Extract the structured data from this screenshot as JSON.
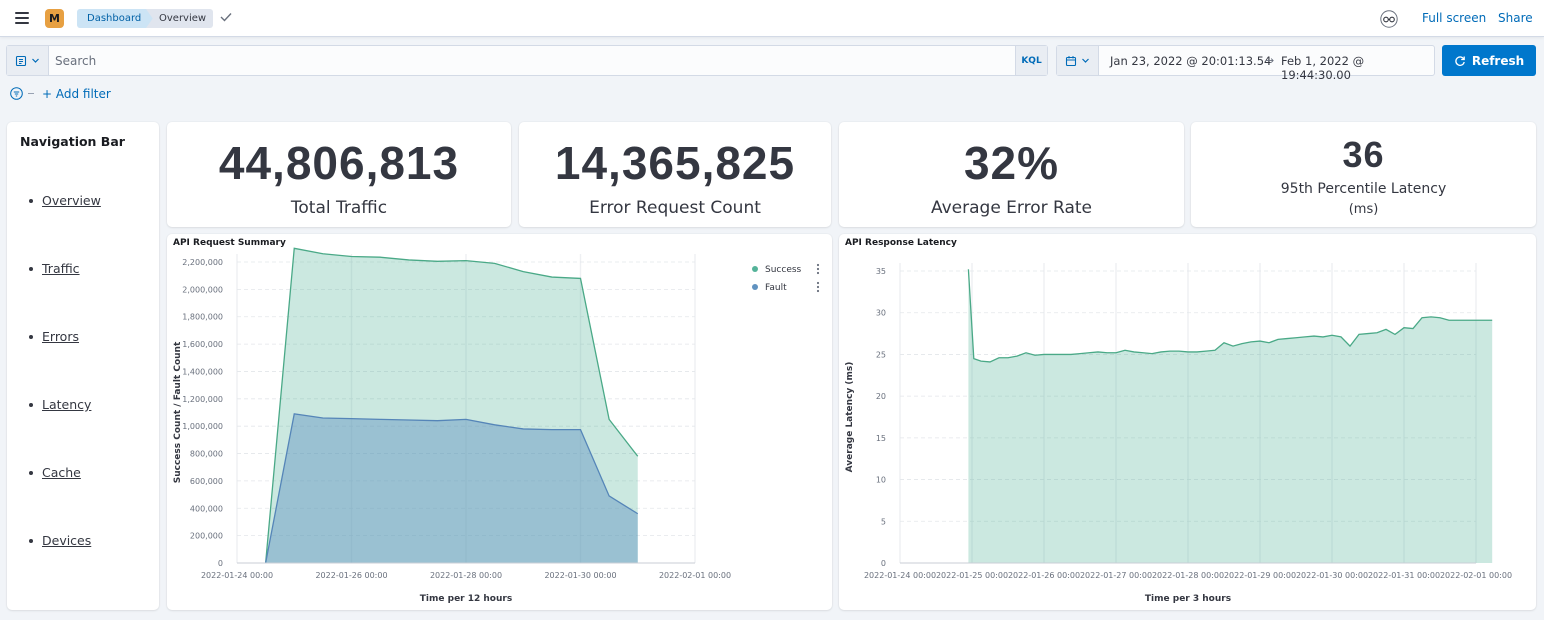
{
  "header": {
    "avatar_letter": "M",
    "breadcrumbs": [
      "Dashboard",
      "Overview"
    ],
    "full_screen": "Full screen",
    "share": "Share"
  },
  "query": {
    "search_placeholder": "Search",
    "kql": "KQL",
    "date_start": "Jan 23, 2022 @ 20:01:13.54",
    "date_arrow": "→",
    "date_end": "Feb 1, 2022 @ 19:44:30.00",
    "refresh": "Refresh",
    "add_filter": "+ Add filter"
  },
  "nav": {
    "title": "Navigation Bar",
    "items": [
      "Overview",
      "Traffic",
      "Errors",
      "Latency",
      "Cache",
      "Devices"
    ]
  },
  "metrics": [
    {
      "value": "44,806,813",
      "label": "Total Traffic"
    },
    {
      "value": "14,365,825",
      "label": "Error Request Count"
    },
    {
      "value": "32%",
      "label": "Average Error Rate"
    },
    {
      "value": "36",
      "label": "95th Percentile Latency",
      "label2": "(ms)"
    }
  ],
  "colors": {
    "success": "#54b399",
    "fault": "#6092c0",
    "accent": "#0077cc"
  },
  "charts": {
    "request_title": "API Request Summary",
    "latency_title": "API Response Latency"
  },
  "chart_data": [
    {
      "type": "area",
      "title": "API Request Summary",
      "xlabel": "Time per 12 hours",
      "ylabel": "Success Count / Fault Count",
      "ylim": [
        0,
        2200000
      ],
      "yticks": [
        0,
        200000,
        400000,
        600000,
        800000,
        1000000,
        1200000,
        1400000,
        1600000,
        1800000,
        2000000,
        2200000
      ],
      "ytick_labels": [
        "0",
        "200,000",
        "400,000",
        "600,000",
        "800,000",
        "1,000,000",
        "1,200,000",
        "1,400,000",
        "1,600,000",
        "1,800,000",
        "2,000,000",
        "2,200,000"
      ],
      "xlim": [
        0,
        16
      ],
      "xticks": [
        0,
        4,
        8,
        12,
        16
      ],
      "xtick_labels": [
        "2022-01-24 00:00",
        "2022-01-26 00:00",
        "2022-01-28 00:00",
        "2022-01-30 00:00",
        "2022-02-01 00:00"
      ],
      "legend_position": "top-right",
      "grid": true,
      "x": [
        1,
        2,
        3,
        4,
        5,
        6,
        7,
        8,
        9,
        10,
        11,
        12,
        13,
        14,
        15
      ],
      "series": [
        {
          "name": "Success",
          "values": [
            0,
            2300000,
            2260000,
            2240000,
            2235000,
            2215000,
            2205000,
            2210000,
            2190000,
            2130000,
            2090000,
            2080000,
            1050000,
            780000,
            null
          ]
        },
        {
          "name": "Fault",
          "values": [
            0,
            1090000,
            1060000,
            1055000,
            1050000,
            1045000,
            1040000,
            1050000,
            1010000,
            980000,
            975000,
            975000,
            490000,
            360000,
            null
          ]
        }
      ]
    },
    {
      "type": "area",
      "title": "API Response Latency",
      "xlabel": "Time per 3 hours",
      "ylabel": "Average Latency (ms)",
      "ylim": [
        0,
        35
      ],
      "yticks": [
        0,
        5,
        10,
        15,
        20,
        25,
        30,
        35
      ],
      "xlim": [
        0,
        64
      ],
      "xticks": [
        0,
        8,
        16,
        24,
        32,
        40,
        48,
        56,
        64
      ],
      "xtick_labels": [
        "2022-01-24 00:00",
        "2022-01-25 00:00",
        "2022-01-26 00:00",
        "2022-01-27 00:00",
        "2022-01-28 00:00",
        "2022-01-29 00:00",
        "2022-01-30 00:00",
        "2022-01-31 00:00",
        "2022-02-01 00:00"
      ],
      "grid": true,
      "x": [
        7.6,
        8.2,
        9,
        10,
        11,
        12,
        13,
        14,
        15,
        16,
        17,
        18,
        19,
        20,
        21,
        22,
        23,
        24,
        25,
        26,
        27,
        28,
        29,
        30,
        31,
        32,
        33,
        34,
        35,
        36,
        37,
        38,
        39,
        40,
        41,
        42,
        43,
        44,
        45,
        46,
        47,
        48,
        49,
        50,
        51,
        52,
        53,
        54,
        55,
        56,
        57,
        58,
        59,
        60,
        61,
        62,
        63,
        64,
        65,
        65.8
      ],
      "series": [
        {
          "name": "Average Latency",
          "values": [
            35.2,
            24.5,
            24.2,
            24.1,
            24.6,
            24.6,
            24.8,
            25.2,
            24.9,
            25.0,
            25.0,
            25.0,
            25.0,
            25.1,
            25.2,
            25.3,
            25.2,
            25.2,
            25.5,
            25.3,
            25.2,
            25.1,
            25.3,
            25.4,
            25.4,
            25.3,
            25.3,
            25.4,
            25.5,
            26.4,
            26.0,
            26.3,
            26.5,
            26.6,
            26.4,
            26.8,
            26.9,
            27.0,
            27.1,
            27.2,
            27.1,
            27.3,
            27.1,
            26.0,
            27.4,
            27.5,
            27.6,
            28.0,
            27.4,
            28.2,
            28.1,
            29.4,
            29.5,
            29.4,
            29.1,
            29.1,
            29.1,
            29.1,
            29.1,
            29.1
          ]
        }
      ]
    }
  ]
}
